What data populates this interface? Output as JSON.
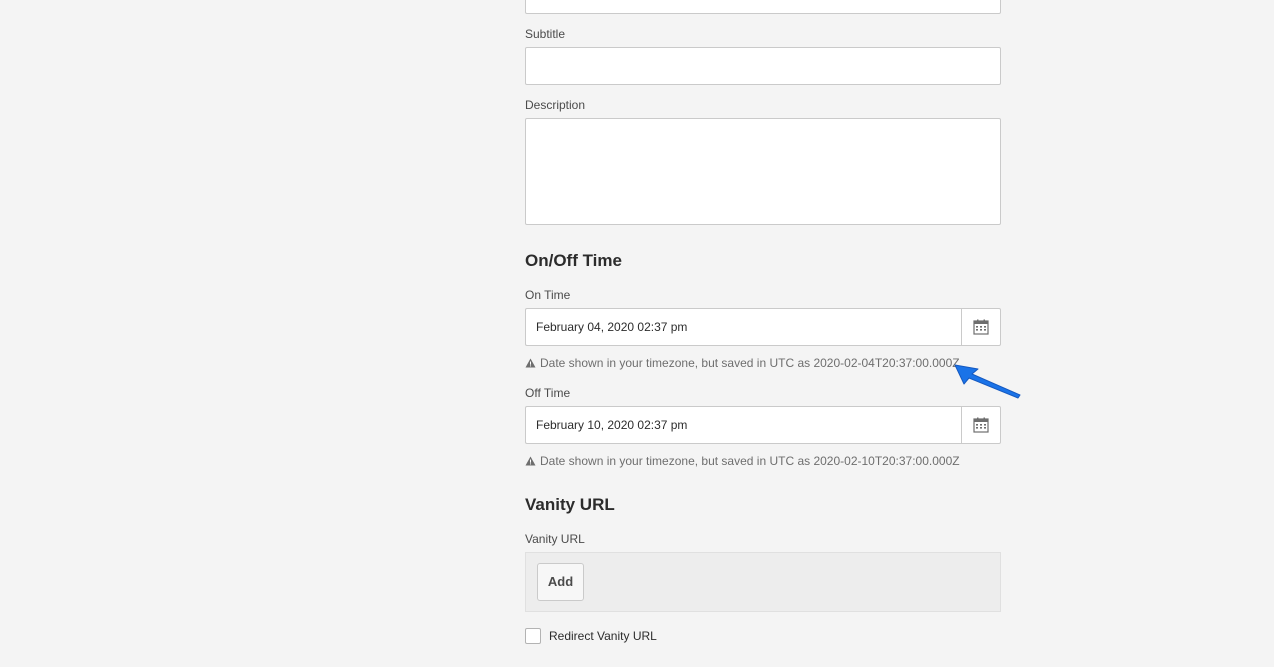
{
  "form": {
    "subtitle": {
      "label": "Subtitle",
      "value": ""
    },
    "description": {
      "label": "Description",
      "value": ""
    }
  },
  "on_off_time": {
    "section_title": "On/Off Time",
    "on_time": {
      "label": "On Time",
      "value": "February 04, 2020 02:37 pm",
      "hint": "Date shown in your timezone, but saved in UTC as 2020-02-04T20:37:00.000Z"
    },
    "off_time": {
      "label": "Off Time",
      "value": "February 10, 2020 02:37 pm",
      "hint": "Date shown in your timezone, but saved in UTC as 2020-02-10T20:37:00.000Z"
    }
  },
  "vanity": {
    "section_title": "Vanity URL",
    "label": "Vanity URL",
    "add_label": "Add",
    "redirect_label": "Redirect Vanity URL",
    "redirect_checked": false
  },
  "colors": {
    "background": "#f4f4f4",
    "annotation_arrow": "#1a73e8"
  },
  "icons": {
    "calendar": "calendar-icon",
    "alert": "alert-icon",
    "arrow": "annotation-arrow-icon"
  }
}
